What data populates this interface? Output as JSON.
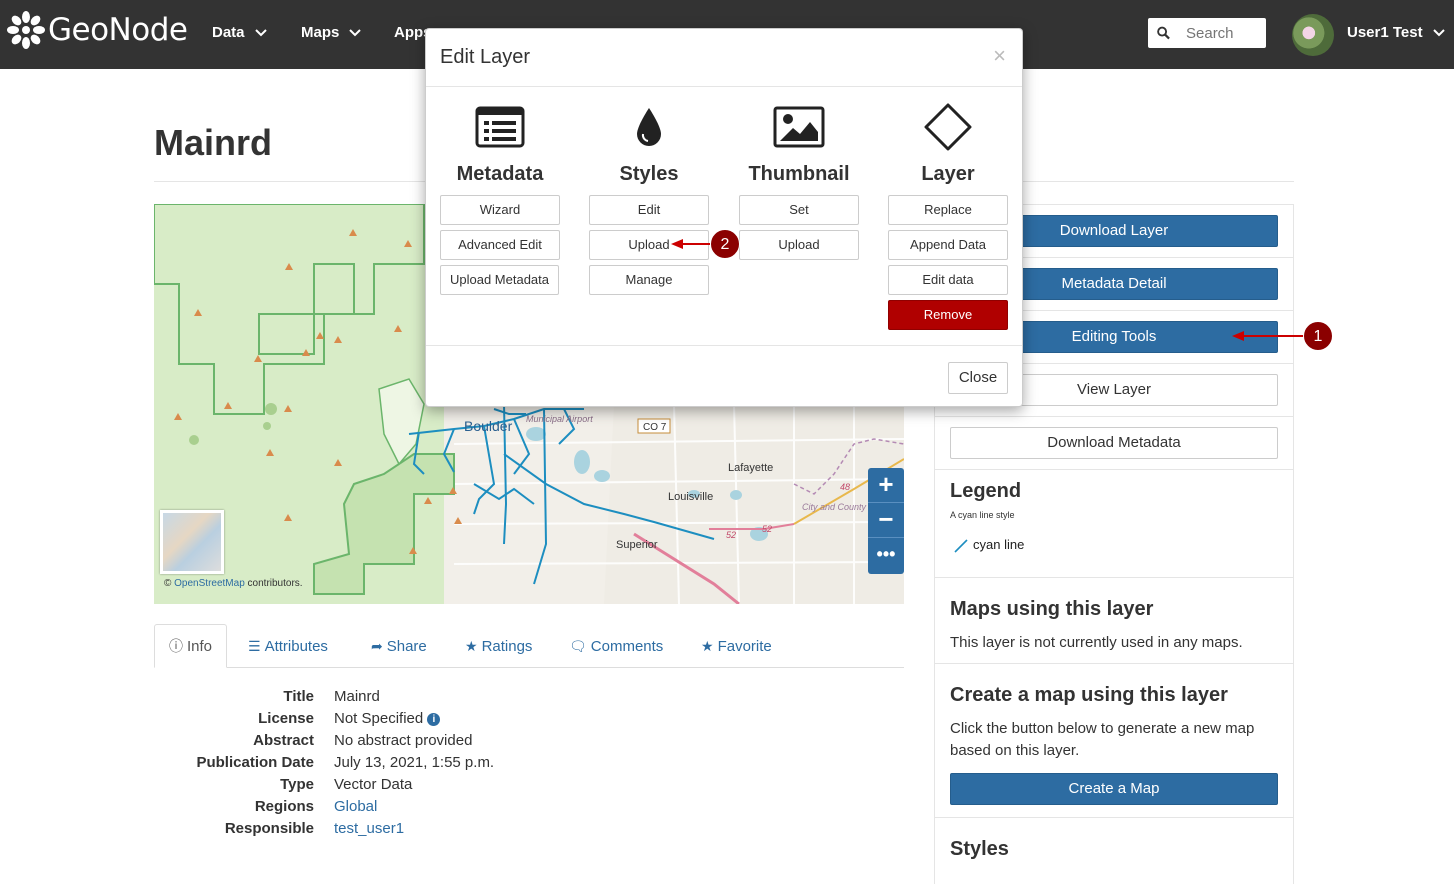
{
  "navbar": {
    "brand": "GeoNode",
    "menu": [
      {
        "label": "Data"
      },
      {
        "label": "Maps"
      },
      {
        "label": "Apps"
      }
    ],
    "search_placeholder": "Search",
    "user": "User1 Test"
  },
  "page": {
    "title": "Mainrd"
  },
  "map": {
    "labels": {
      "boulder": "Boulder",
      "airport": "Municipal Airport",
      "co7": "CO 7",
      "lafayette": "Lafayette",
      "louisville": "Louisville",
      "superior": "Superior",
      "broomfield": "City and County of Broomfield",
      "r48": "48",
      "r52a": "52",
      "r52b": "52"
    },
    "zoom_in": "+",
    "zoom_out": "−",
    "more": "•••",
    "attribution_prefix": "©",
    "attribution_link": "OpenStreetMap",
    "attribution_suffix": "contributors."
  },
  "tabs": [
    {
      "label": "Info"
    },
    {
      "label": "Attributes"
    },
    {
      "label": "Share"
    },
    {
      "label": "Ratings"
    },
    {
      "label": "Comments"
    },
    {
      "label": "Favorite"
    }
  ],
  "info": [
    {
      "label": "Title",
      "value": "Mainrd"
    },
    {
      "label": "License",
      "value": "Not Specified"
    },
    {
      "label": "Abstract",
      "value": "No abstract provided"
    },
    {
      "label": "Publication Date",
      "value": "July 13, 2021, 1:55 p.m."
    },
    {
      "label": "Type",
      "value": "Vector Data"
    },
    {
      "label": "Regions",
      "value": "Global"
    },
    {
      "label": "Responsible",
      "value": "test_user1"
    }
  ],
  "sidebar": {
    "download_layer": "Download Layer",
    "metadata_detail": "Metadata Detail",
    "editing_tools": "Editing Tools",
    "view_layer": "View Layer",
    "download_metadata": "Download Metadata",
    "legend_title": "Legend",
    "legend_style": "A cyan line style",
    "legend_item": "cyan line",
    "maps_title": "Maps using this layer",
    "maps_text": "This layer is not currently used in any maps.",
    "create_title": "Create a map using this layer",
    "create_text": "Click the button below to generate a new map based on this layer.",
    "create_button": "Create a Map",
    "styles_title": "Styles"
  },
  "markers": {
    "one": "1",
    "two": "2"
  },
  "modal": {
    "title": "Edit Layer",
    "close_x": "×",
    "close_button": "Close",
    "columns": {
      "metadata": {
        "title": "Metadata",
        "buttons": [
          "Wizard",
          "Advanced Edit",
          "Upload Metadata"
        ]
      },
      "styles": {
        "title": "Styles",
        "buttons": [
          "Edit",
          "Upload",
          "Manage"
        ]
      },
      "thumbnail": {
        "title": "Thumbnail",
        "buttons": [
          "Set",
          "Upload"
        ]
      },
      "layer": {
        "title": "Layer",
        "buttons": [
          "Replace",
          "Append Data",
          "Edit data",
          "Remove"
        ]
      }
    }
  },
  "colors": {
    "navbar": "#333333",
    "primary": "#2d6ca2",
    "danger": "#b00000",
    "marker": "#8b0000",
    "map_green": "#d8ecc7"
  }
}
